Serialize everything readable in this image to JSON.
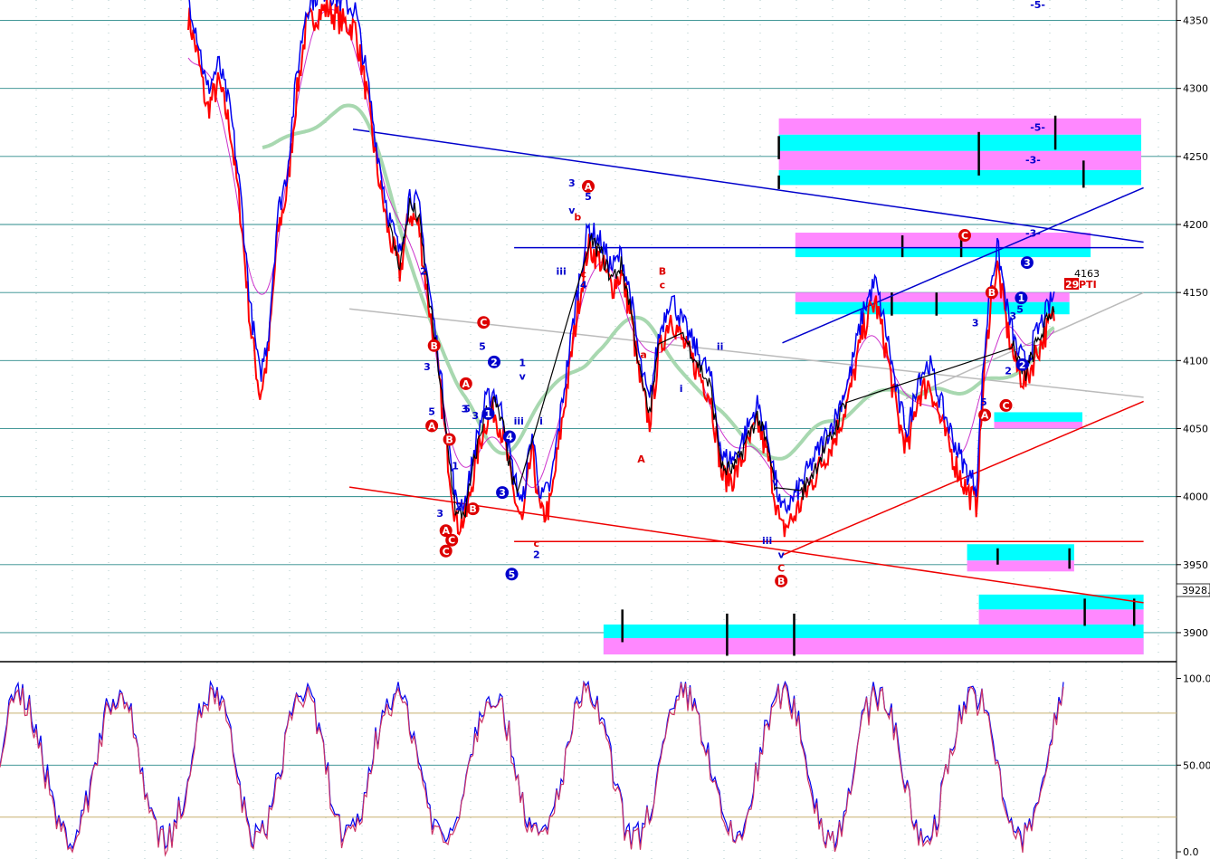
{
  "chart_data": [
    {
      "type": "line",
      "panel": "price",
      "ylim": [
        3880,
        4365
      ],
      "y_ticks": [
        "4350",
        "4300",
        "4250",
        "4200",
        "4150",
        "4100",
        "4050",
        "4000",
        "3950",
        "3900"
      ],
      "last_price_label": "3928.",
      "price_annotation": "4163",
      "box_label": "29",
      "pt_label": "PTI",
      "series": [
        {
          "color": "#ff0000"
        },
        {
          "color": "#0000ee"
        },
        {
          "color": "#000000"
        },
        {
          "color": "#cc33cc"
        },
        {
          "color": "#a8d8b0"
        }
      ],
      "zones": [
        {
          "from_bar": 0.662,
          "to_bar": 0.97,
          "y_top": 4278,
          "y_bot": 4266,
          "color": "#ff88ff"
        },
        {
          "from_bar": 0.662,
          "to_bar": 0.97,
          "y_top": 4266,
          "y_bot": 4254,
          "color": "#00ffff"
        },
        {
          "from_bar": 0.662,
          "to_bar": 0.97,
          "y_top": 4254,
          "y_bot": 4240,
          "color": "#ff88ff"
        },
        {
          "from_bar": 0.662,
          "to_bar": 0.97,
          "y_top": 4240,
          "y_bot": 4229,
          "color": "#00ffff"
        },
        {
          "from_bar": 0.676,
          "to_bar": 0.927,
          "y_top": 4194,
          "y_bot": 4183,
          "color": "#ff88ff"
        },
        {
          "from_bar": 0.676,
          "to_bar": 0.927,
          "y_top": 4183,
          "y_bot": 4176,
          "color": "#00ffff"
        },
        {
          "from_bar": 0.676,
          "to_bar": 0.909,
          "y_top": 4150,
          "y_bot": 4143,
          "color": "#ff88ff"
        },
        {
          "from_bar": 0.676,
          "to_bar": 0.909,
          "y_top": 4143,
          "y_bot": 4134,
          "color": "#00ffff"
        },
        {
          "from_bar": 0.822,
          "to_bar": 0.913,
          "y_top": 3965,
          "y_bot": 3953,
          "color": "#00ffff"
        },
        {
          "from_bar": 0.822,
          "to_bar": 0.913,
          "y_top": 3953,
          "y_bot": 3945,
          "color": "#ff88ff"
        },
        {
          "from_bar": 0.832,
          "to_bar": 0.972,
          "y_top": 3928,
          "y_bot": 3917,
          "color": "#00ffff"
        },
        {
          "from_bar": 0.832,
          "to_bar": 0.972,
          "y_top": 3917,
          "y_bot": 3906,
          "color": "#ff88ff"
        },
        {
          "from_bar": 0.513,
          "to_bar": 0.972,
          "y_top": 3896,
          "y_bot": 3884,
          "color": "#00ffff"
        },
        {
          "from_bar": 0.513,
          "to_bar": 0.972,
          "y_top": 3906,
          "y_bot": 3896,
          "color": "#00ffff"
        },
        {
          "from_bar": 0.513,
          "to_bar": 0.972,
          "y_top": 3896,
          "y_bot": 3884,
          "color": "#ff88ff"
        },
        {
          "from_bar": 0.845,
          "to_bar": 0.92,
          "y_top": 4062,
          "y_bot": 4055,
          "color": "#00ffff"
        },
        {
          "from_bar": 0.845,
          "to_bar": 0.92,
          "y_top": 4055,
          "y_bot": 4050,
          "color": "#ff88ff"
        }
      ],
      "wave_labels": [
        {
          "text": "-5-",
          "x": 0.882,
          "y": 4359,
          "color": "#0000cc"
        },
        {
          "text": "-5-",
          "x": 0.882,
          "y": 4269,
          "color": "#0000cc"
        },
        {
          "text": "-3-",
          "x": 0.878,
          "y": 4245,
          "color": "#0000cc"
        },
        {
          "text": "-3-",
          "x": 0.878,
          "y": 4191,
          "color": "#0000cc"
        },
        {
          "text": "3",
          "x": 0.486,
          "y": 4228,
          "color": "#0000cc"
        },
        {
          "text": "v",
          "x": 0.486,
          "y": 4208,
          "color": "#0000cc"
        },
        {
          "text": "5",
          "x": 0.5,
          "y": 4218,
          "color": "#0000cc"
        },
        {
          "text": "b",
          "x": 0.491,
          "y": 4203,
          "color": "#dd0000"
        },
        {
          "text": "c",
          "x": 0.496,
          "y": 4161,
          "color": "#dd0000"
        },
        {
          "text": "4",
          "x": 0.496,
          "y": 4153,
          "color": "#0000cc"
        },
        {
          "text": "iii",
          "x": 0.477,
          "y": 4163,
          "color": "#0000cc"
        },
        {
          "text": "B",
          "x": 0.563,
          "y": 4163,
          "color": "#dd0000"
        },
        {
          "text": "c",
          "x": 0.563,
          "y": 4153,
          "color": "#dd0000"
        },
        {
          "text": "a",
          "x": 0.547,
          "y": 4102,
          "color": "#dd0000"
        },
        {
          "text": "A",
          "x": 0.545,
          "y": 4025,
          "color": "#dd0000"
        },
        {
          "text": "ii",
          "x": 0.612,
          "y": 4108,
          "color": "#0000cc"
        },
        {
          "text": "i",
          "x": 0.579,
          "y": 4077,
          "color": "#0000cc"
        },
        {
          "text": "2",
          "x": 0.36,
          "y": 4163,
          "color": "#0000cc"
        },
        {
          "text": "3",
          "x": 0.363,
          "y": 4093,
          "color": "#0000cc"
        },
        {
          "text": "5",
          "x": 0.367,
          "y": 4060,
          "color": "#0000cc"
        },
        {
          "text": "5",
          "x": 0.41,
          "y": 4108,
          "color": "#0000cc"
        },
        {
          "text": "3",
          "x": 0.395,
          "y": 4062,
          "color": "#0000cc"
        },
        {
          "text": "5",
          "x": 0.397,
          "y": 4062,
          "color": "#0000cc"
        },
        {
          "text": "3",
          "x": 0.404,
          "y": 4057,
          "color": "#0000cc"
        },
        {
          "text": "1",
          "x": 0.444,
          "y": 4096,
          "color": "#0000cc"
        },
        {
          "text": "v",
          "x": 0.444,
          "y": 4086,
          "color": "#0000cc"
        },
        {
          "text": "iii",
          "x": 0.441,
          "y": 4053,
          "color": "#0000cc"
        },
        {
          "text": "i",
          "x": 0.46,
          "y": 4053,
          "color": "#0000cc"
        },
        {
          "text": "1",
          "x": 0.387,
          "y": 4020,
          "color": "#0000cc"
        },
        {
          "text": "2",
          "x": 0.39,
          "y": 3990,
          "color": "#0000cc"
        },
        {
          "text": "3",
          "x": 0.374,
          "y": 3985,
          "color": "#0000cc"
        },
        {
          "text": "c",
          "x": 0.456,
          "y": 3963,
          "color": "#dd0000"
        },
        {
          "text": "2",
          "x": 0.456,
          "y": 3955,
          "color": "#0000cc"
        },
        {
          "text": "v",
          "x": 0.659,
          "y": 4008,
          "color": "#0000cc"
        },
        {
          "text": "iii",
          "x": 0.652,
          "y": 3965,
          "color": "#0000cc"
        },
        {
          "text": "v",
          "x": 0.664,
          "y": 3955,
          "color": "#0000cc"
        },
        {
          "text": "C",
          "x": 0.664,
          "y": 3945,
          "color": "#dd0000"
        },
        {
          "text": "3",
          "x": 0.829,
          "y": 4125,
          "color": "#0000cc"
        },
        {
          "text": "5",
          "x": 0.836,
          "y": 4067,
          "color": "#0000cc"
        },
        {
          "text": "2",
          "x": 0.857,
          "y": 4090,
          "color": "#0000cc"
        },
        {
          "text": "3",
          "x": 0.861,
          "y": 4130,
          "color": "#0000cc"
        },
        {
          "text": "5",
          "x": 0.867,
          "y": 4135,
          "color": "#0000cc"
        }
      ],
      "wave_circles": [
        {
          "text": "A",
          "x": 0.5,
          "y": 4228,
          "color": "#dd0000"
        },
        {
          "text": "C",
          "x": 0.411,
          "y": 4128,
          "color": "#dd0000"
        },
        {
          "text": "B",
          "x": 0.369,
          "y": 4111,
          "color": "#dd0000"
        },
        {
          "text": "A",
          "x": 0.396,
          "y": 4083,
          "color": "#dd0000"
        },
        {
          "text": "A",
          "x": 0.367,
          "y": 4052,
          "color": "#dd0000"
        },
        {
          "text": "B",
          "x": 0.382,
          "y": 4042,
          "color": "#dd0000"
        },
        {
          "text": "A",
          "x": 0.379,
          "y": 3975,
          "color": "#dd0000"
        },
        {
          "text": "C",
          "x": 0.384,
          "y": 3968,
          "color": "#dd0000"
        },
        {
          "text": "C",
          "x": 0.379,
          "y": 3960,
          "color": "#dd0000"
        },
        {
          "text": "B",
          "x": 0.402,
          "y": 3991,
          "color": "#dd0000"
        },
        {
          "text": "2",
          "x": 0.42,
          "y": 4099,
          "color": "#0000cc"
        },
        {
          "text": "1",
          "x": 0.415,
          "y": 4061,
          "color": "#0000cc"
        },
        {
          "text": "4",
          "x": 0.433,
          "y": 4044,
          "color": "#0000cc"
        },
        {
          "text": "3",
          "x": 0.427,
          "y": 4003,
          "color": "#0000cc"
        },
        {
          "text": "5",
          "x": 0.435,
          "y": 3943,
          "color": "#0000cc"
        },
        {
          "text": "B",
          "x": 0.664,
          "y": 3938,
          "color": "#dd0000"
        },
        {
          "text": "C",
          "x": 0.82,
          "y": 4192,
          "color": "#dd0000"
        },
        {
          "text": "B",
          "x": 0.843,
          "y": 4150,
          "color": "#dd0000"
        },
        {
          "text": "3",
          "x": 0.873,
          "y": 4172,
          "color": "#0000cc"
        },
        {
          "text": "1",
          "x": 0.868,
          "y": 4146,
          "color": "#0000cc"
        },
        {
          "text": "2",
          "x": 0.869,
          "y": 4097,
          "color": "#0000cc"
        },
        {
          "text": "C",
          "x": 0.855,
          "y": 4067,
          "color": "#dd0000"
        },
        {
          "text": "A",
          "x": 0.837,
          "y": 4060,
          "color": "#dd0000"
        }
      ],
      "trendlines": [
        {
          "x1": 0.3,
          "y1": 4270,
          "x2": 0.972,
          "y2": 4187,
          "color": "#0000cc",
          "width": 1.5
        },
        {
          "x1": 0.437,
          "y1": 4183,
          "x2": 0.972,
          "y2": 4183,
          "color": "#0000cc",
          "width": 1.5
        },
        {
          "x1": 0.665,
          "y1": 4113,
          "x2": 0.972,
          "y2": 4227,
          "color": "#0000cc",
          "width": 1.5
        },
        {
          "x1": 0.297,
          "y1": 4007,
          "x2": 0.972,
          "y2": 3922,
          "color": "#ee0000",
          "width": 1.5
        },
        {
          "x1": 0.437,
          "y1": 3967,
          "x2": 0.972,
          "y2": 3967,
          "color": "#ee0000",
          "width": 1.5
        },
        {
          "x1": 0.665,
          "y1": 3957,
          "x2": 0.972,
          "y2": 4070,
          "color": "#ee0000",
          "width": 1.5
        },
        {
          "x1": 0.297,
          "y1": 4138,
          "x2": 0.972,
          "y2": 4073,
          "color": "#bbbbbb",
          "width": 1.5
        },
        {
          "x1": 0.77,
          "y1": 4072,
          "x2": 0.972,
          "y2": 4150,
          "color": "#bbbbbb",
          "width": 1.5
        }
      ]
    },
    {
      "type": "line",
      "panel": "oscillator",
      "ylim": [
        0,
        105
      ],
      "y_ticks": [
        "100.0",
        "50.00",
        "0.0"
      ],
      "ref_levels": [
        80,
        20
      ],
      "series": [
        {
          "color": "#0000ee"
        },
        {
          "color": "#cc3366"
        }
      ]
    }
  ]
}
